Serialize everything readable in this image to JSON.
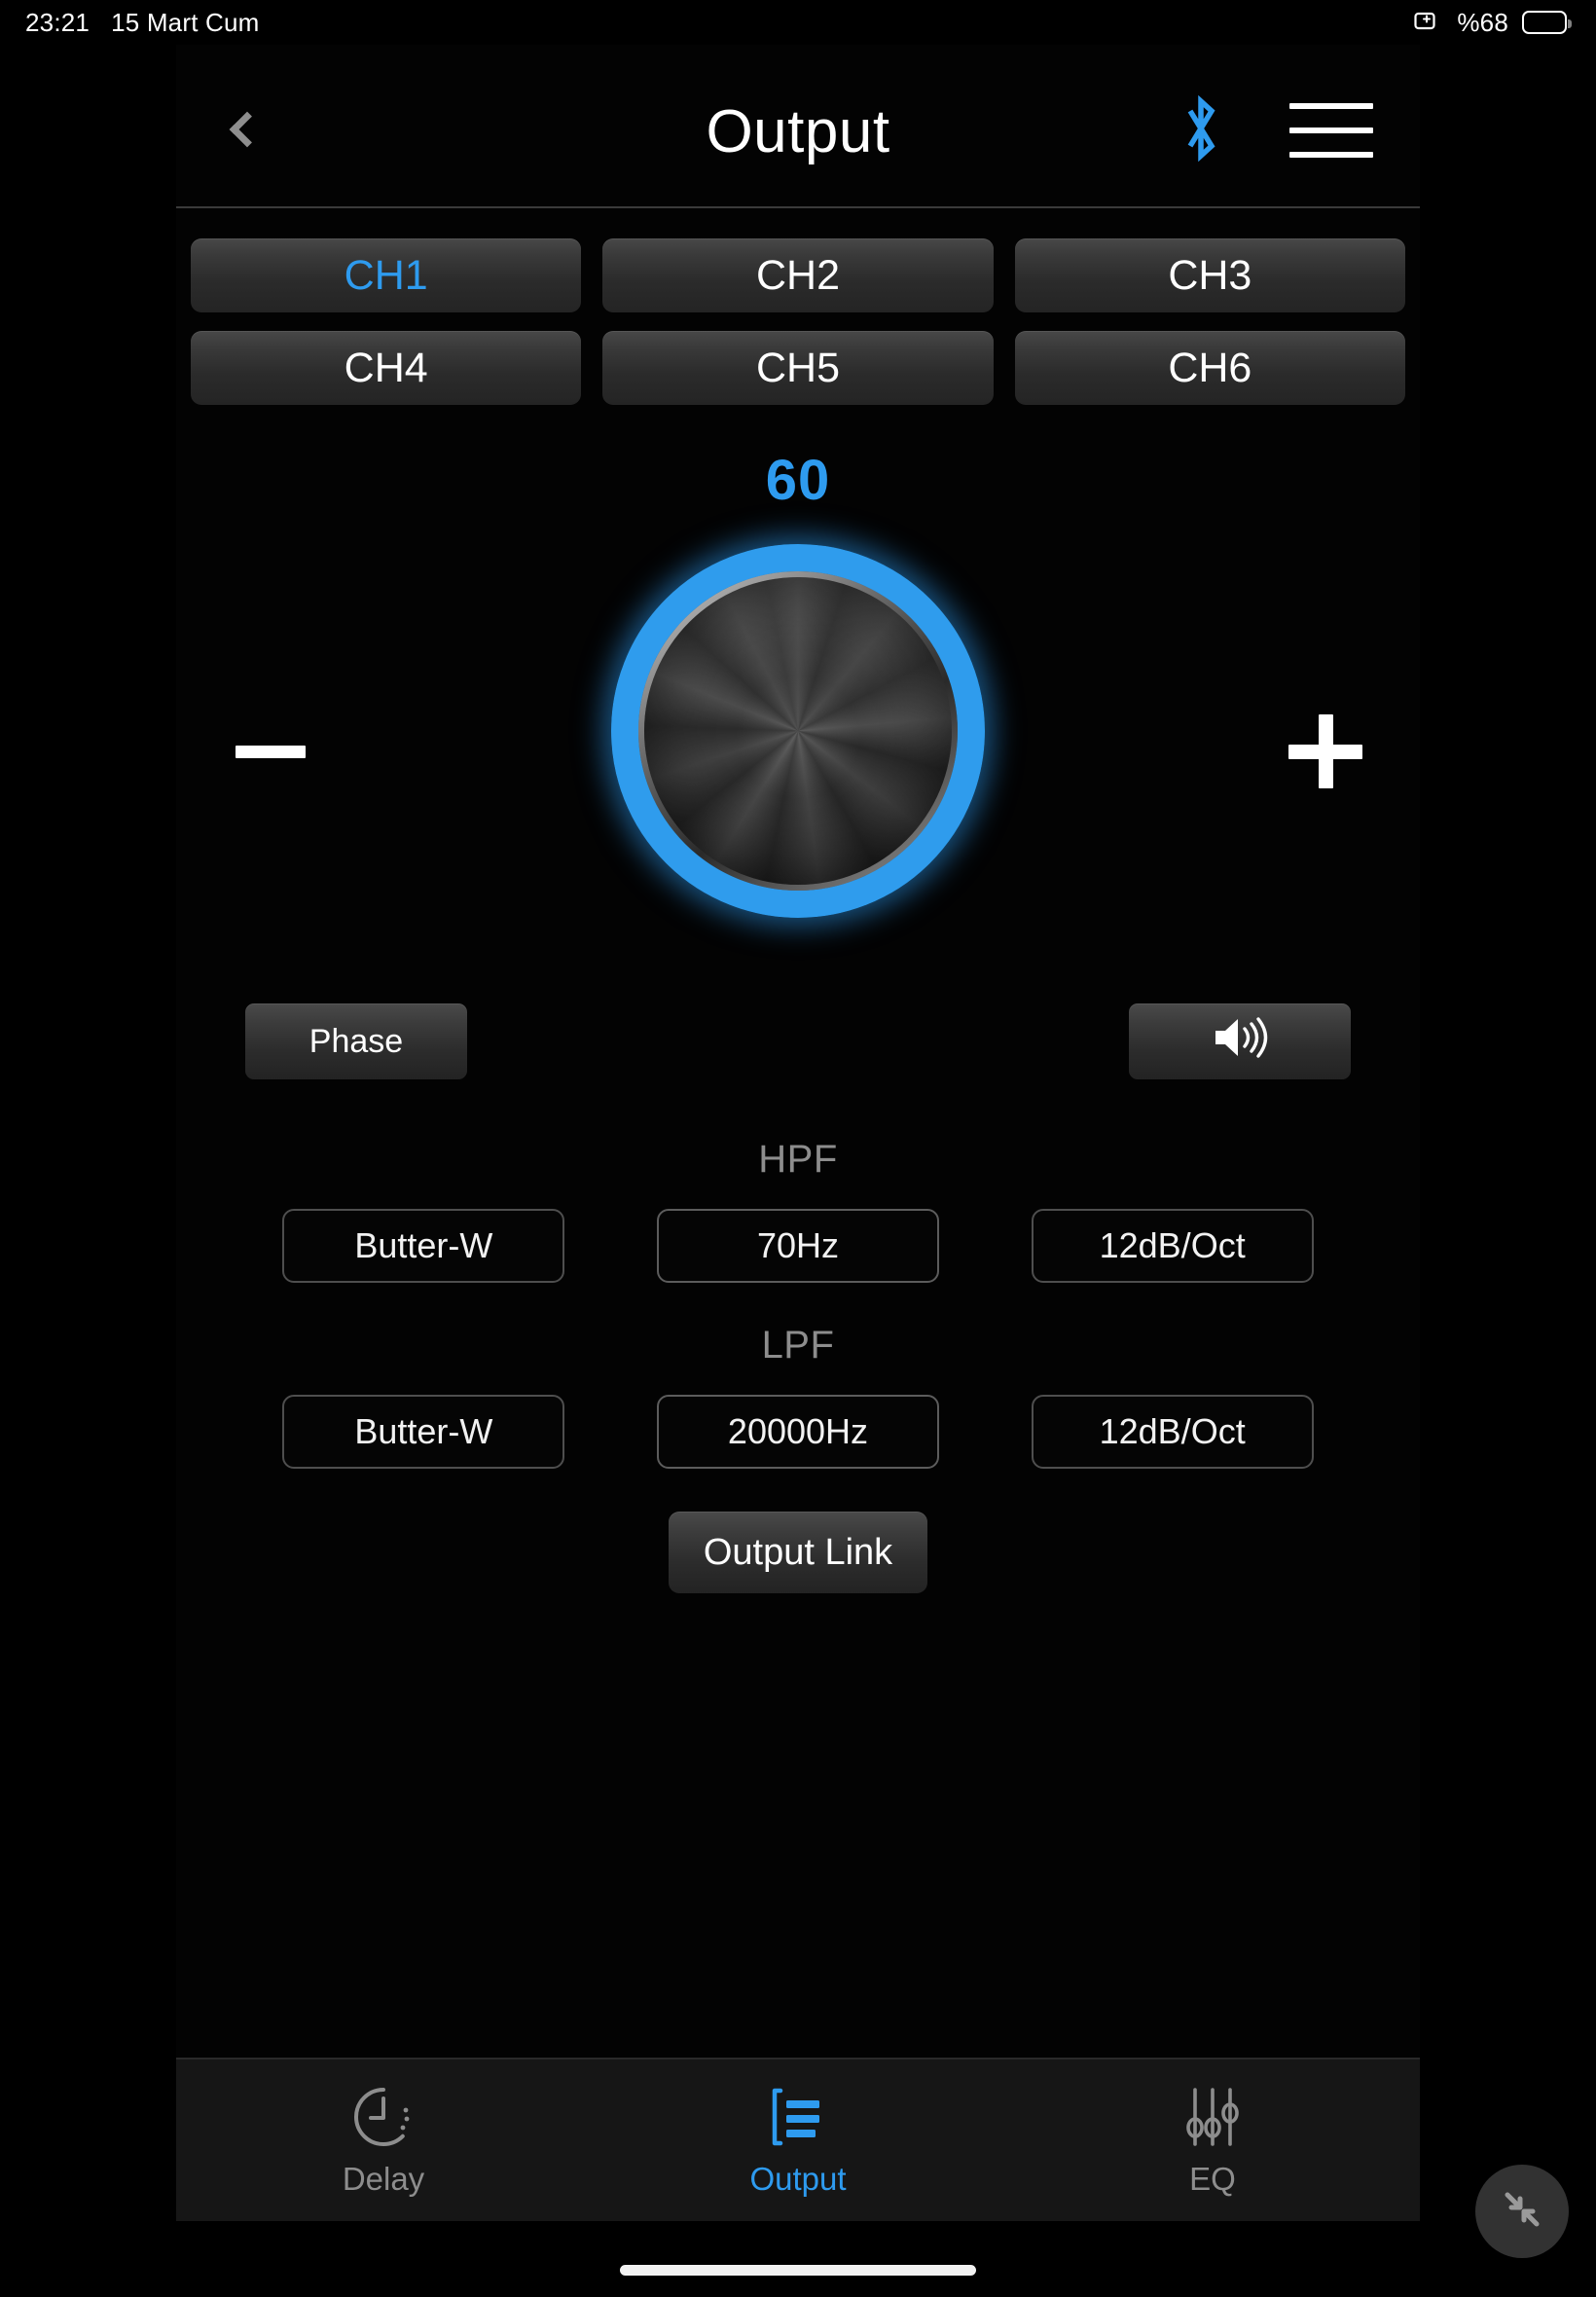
{
  "statusbar": {
    "time": "23:21",
    "date": "15 Mart Cum",
    "battery_percent": "%68",
    "screenshare_icon": "screen-mirroring-icon",
    "battery_icon": "battery-icon"
  },
  "header": {
    "title": "Output",
    "back_icon": "chevron-left-icon",
    "bluetooth_icon": "bluetooth-icon",
    "menu_icon": "hamburger-menu-icon",
    "bluetooth_color": "#2e9bef"
  },
  "channels": {
    "active": "CH1",
    "items": [
      {
        "label": "CH1",
        "active": true
      },
      {
        "label": "CH2",
        "active": false
      },
      {
        "label": "CH3",
        "active": false
      },
      {
        "label": "CH4",
        "active": false
      },
      {
        "label": "CH5",
        "active": false
      },
      {
        "label": "CH6",
        "active": false
      }
    ]
  },
  "gain": {
    "value": "60",
    "value_color": "#2e9bef",
    "knob_ring_color": "#2f9ced",
    "decrement_icon": "minus-icon",
    "increment_icon": "plus-icon"
  },
  "controls": {
    "phase_label": "Phase",
    "mute_icon": "speaker-volume-icon"
  },
  "hpf": {
    "label": "HPF",
    "filter_type": "Butter-W",
    "frequency": "70Hz",
    "slope": "12dB/Oct"
  },
  "lpf": {
    "label": "LPF",
    "filter_type": "Butter-W",
    "frequency": "20000Hz",
    "slope": "12dB/Oct"
  },
  "output_link": {
    "label": "Output Link"
  },
  "tabbar": {
    "active": "Output",
    "items": [
      {
        "label": "Delay",
        "icon": "clock-delay-icon",
        "active": false
      },
      {
        "label": "Output",
        "icon": "output-list-icon",
        "active": true
      },
      {
        "label": "EQ",
        "icon": "eq-sliders-icon",
        "active": false
      }
    ]
  },
  "fab": {
    "icon": "collapse-arrows-icon"
  }
}
